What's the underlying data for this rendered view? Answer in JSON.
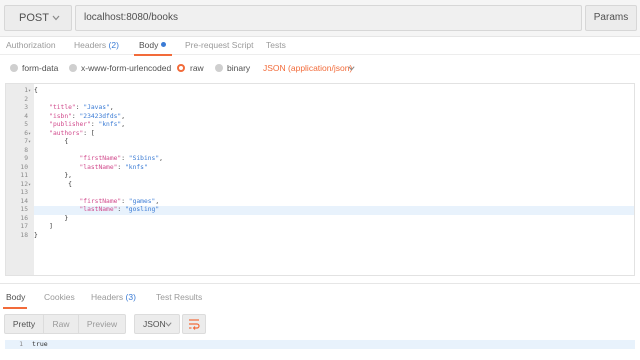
{
  "request": {
    "method": "POST",
    "url": "localhost:8080/books",
    "params_label": "Params"
  },
  "request_tabs": [
    {
      "label": "Authorization"
    },
    {
      "label": "Headers",
      "count": "(2)"
    },
    {
      "label": "Body",
      "active": true
    },
    {
      "label": "Pre-request Script"
    },
    {
      "label": "Tests"
    }
  ],
  "body_types": {
    "options": [
      "form-data",
      "x-www-form-urlencoded",
      "raw",
      "binary"
    ],
    "selected": "raw",
    "content_type": "JSON (application/json)"
  },
  "editor": {
    "lines": [
      {
        "n": "1",
        "fold": "▾",
        "text": "{"
      },
      {
        "n": "2",
        "fold": "",
        "text": ""
      },
      {
        "n": "3",
        "fold": "",
        "text": "    \"title\": \"Javas\","
      },
      {
        "n": "4",
        "fold": "",
        "text": "    \"isbn\": \"23423dfds\","
      },
      {
        "n": "5",
        "fold": "",
        "text": "    \"publisher\": \"knfs\","
      },
      {
        "n": "6",
        "fold": "▾",
        "text": "    \"authors\": ["
      },
      {
        "n": "7",
        "fold": "▾",
        "text": "        {"
      },
      {
        "n": "8",
        "fold": "",
        "text": ""
      },
      {
        "n": "9",
        "fold": "",
        "text": "            \"firstName\": \"Sibins\","
      },
      {
        "n": "10",
        "fold": "",
        "text": "            \"lastName\": \"knfs\""
      },
      {
        "n": "11",
        "fold": "",
        "text": "        },"
      },
      {
        "n": "12",
        "fold": "▾",
        "text": "         {"
      },
      {
        "n": "13",
        "fold": "",
        "text": ""
      },
      {
        "n": "14",
        "fold": "",
        "text": "            \"firstName\": \"games\","
      },
      {
        "n": "15",
        "fold": "",
        "text": "            \"lastName\": \"gosling\""
      },
      {
        "n": "16",
        "fold": "",
        "text": "        }"
      },
      {
        "n": "17",
        "fold": "",
        "text": "    ]"
      },
      {
        "n": "18",
        "fold": "",
        "text": "}"
      }
    ],
    "highlighted_line": "15"
  },
  "response_tabs": [
    {
      "label": "Body",
      "active": true
    },
    {
      "label": "Cookies"
    },
    {
      "label": "Headers",
      "count": "(3)"
    },
    {
      "label": "Test Results"
    }
  ],
  "response_toolbar": {
    "views": [
      "Pretty",
      "Raw",
      "Preview"
    ],
    "active_view": "Pretty",
    "format": "JSON",
    "wrap_icon": "wrap-lines-icon"
  },
  "response_body": {
    "lines": [
      {
        "n": "1",
        "text": "true"
      }
    ]
  },
  "colors": {
    "accent": "#f26b3a",
    "link_blue": "#3a7bd5",
    "json_key": "#d14a8c",
    "json_string": "#3a7bd5"
  }
}
